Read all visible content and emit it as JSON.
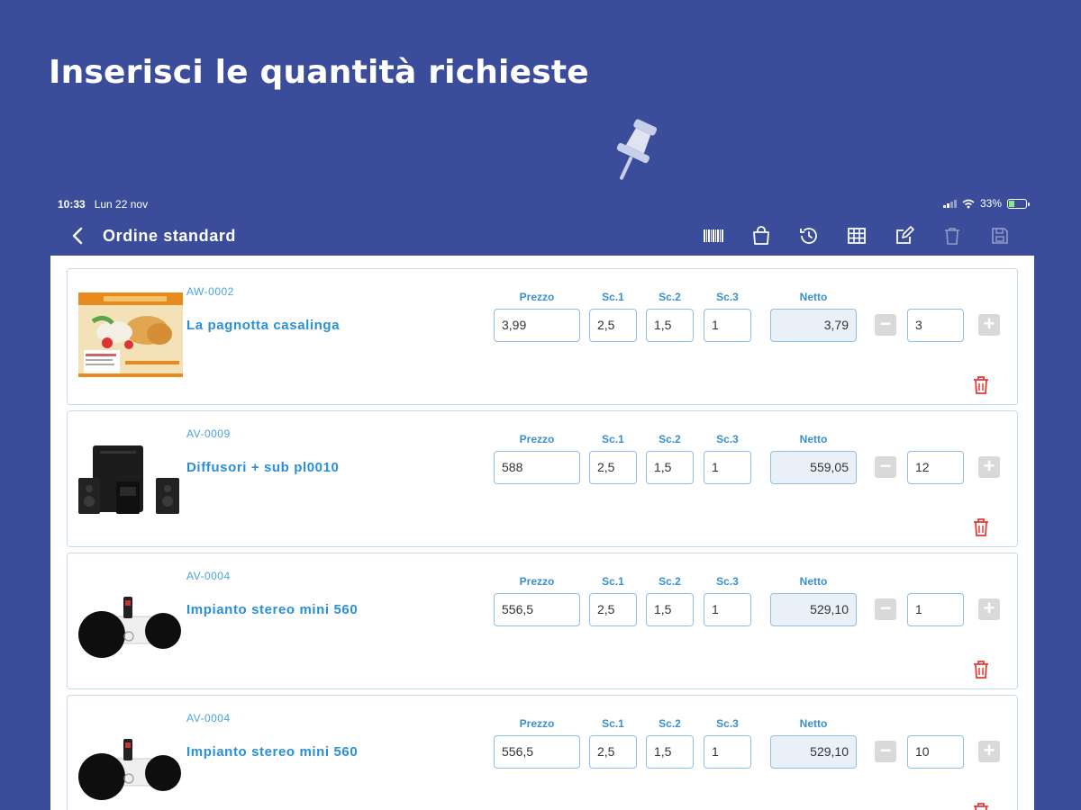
{
  "headline": "Inserisci le quantità richieste",
  "status": {
    "time": "10:33",
    "date": "Lun 22 nov",
    "battery": "33%"
  },
  "nav": {
    "title": "Ordine standard",
    "icons": [
      "barcode-icon",
      "shopping-bag-icon",
      "history-icon",
      "grid-icon",
      "edit-icon",
      "trash-icon",
      "save-icon"
    ]
  },
  "labels": {
    "prezzo": "Prezzo",
    "sc1": "Sc.1",
    "sc2": "Sc.2",
    "sc3": "Sc.3",
    "netto": "Netto"
  },
  "items": [
    {
      "code": "AW-0002",
      "name": "La pagnotta casalinga",
      "prezzo": "3,99",
      "sc1": "2,5",
      "sc2": "1,5",
      "sc3": "1",
      "netto": "3,79",
      "qty": "3",
      "image": "bread-package"
    },
    {
      "code": "AV-0009",
      "name": "Diffusori + sub pl0010",
      "prezzo": "588",
      "sc1": "2,5",
      "sc2": "1,5",
      "sc3": "1",
      "netto": "559,05",
      "qty": "12",
      "image": "speakers"
    },
    {
      "code": "AV-0004",
      "name": "Impianto stereo mini 560",
      "prezzo": "556,5",
      "sc1": "2,5",
      "sc2": "1,5",
      "sc3": "1",
      "netto": "529,10",
      "qty": "1",
      "image": "stereo-dock"
    },
    {
      "code": "AV-0004",
      "name": "Impianto stereo mini 560",
      "prezzo": "556,5",
      "sc1": "2,5",
      "sc2": "1,5",
      "sc3": "1",
      "netto": "529,10",
      "qty": "10",
      "image": "stereo-dock"
    }
  ],
  "colors": {
    "background": "#3a4c9a",
    "accent": "#2b8fd6",
    "delete": "#e53935",
    "fieldBorder": "#8fbfe6"
  }
}
